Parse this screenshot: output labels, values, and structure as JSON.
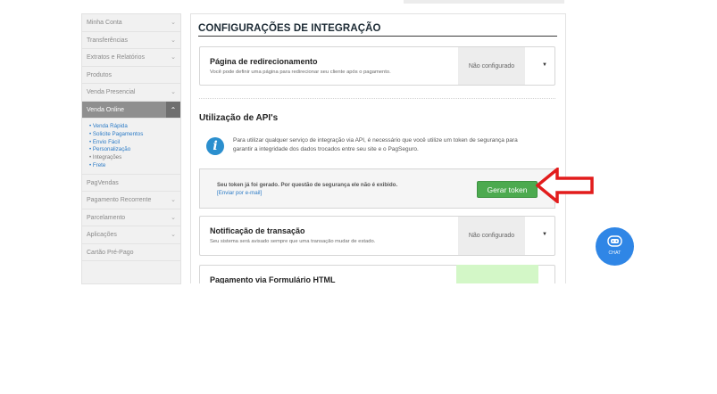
{
  "sidebar": {
    "items_top": [
      {
        "label": "Minha Conta",
        "chevron": true
      },
      {
        "label": "Transferências",
        "chevron": true
      },
      {
        "label": "Extratos e Relatórios",
        "chevron": true
      },
      {
        "label": "Produtos",
        "chevron": false
      },
      {
        "label": "Venda Presencial",
        "chevron": true
      }
    ],
    "active_item": {
      "label": "Venda Online"
    },
    "subitems": [
      {
        "label": "• Venda Rápida"
      },
      {
        "label": "• Solicite Pagamentos"
      },
      {
        "label": "• Envio Fácil"
      },
      {
        "label": "• Personalização"
      },
      {
        "label": "• Integrações"
      },
      {
        "label": "• Frete"
      }
    ],
    "items_bottom": [
      {
        "label": "PagVendas",
        "chevron": false
      },
      {
        "label": "Pagamento Recorrente",
        "chevron": true
      },
      {
        "label": "Parcelamento",
        "chevron": true
      },
      {
        "label": "Aplicações",
        "chevron": true
      },
      {
        "label": "Cartão Pré-Pago",
        "chevron": false
      }
    ]
  },
  "main": {
    "title": "CONFIGURAÇÕES DE INTEGRAÇÃO",
    "redirect": {
      "title": "Página de redirecionamento",
      "description": "Você pode definir uma página para redirecionar seu cliente após o pagamento.",
      "status": "Não configurado",
      "caret": "▼"
    },
    "api_section_title": "Utilização de API's",
    "info": {
      "icon_glyph": "i",
      "text": "Para utilizar qualquer serviço de integração via API, é necessário que você utilize um token de segurança para garantir a integridade dos dados trocados entre seu site e o PagSeguro."
    },
    "token": {
      "text": "Seu token já foi gerado. Por questão de segurança ele não é exibido.",
      "link": "[Enviar por e-mail]",
      "button": "Gerar token"
    },
    "notification": {
      "title": "Notificação de transação",
      "description": "Seu sistema será avisado sempre que uma transação mudar de estado.",
      "status": "Não configurado",
      "caret": "▼"
    },
    "html_payment": {
      "title": "Pagamento via Formulário HTML"
    }
  },
  "chat": {
    "label": "CHAT"
  },
  "colors": {
    "accent_green": "#4caa4f",
    "link_blue": "#2c7bc6",
    "chat_blue": "#2f86e6",
    "arrow_red": "#e21c1c"
  }
}
